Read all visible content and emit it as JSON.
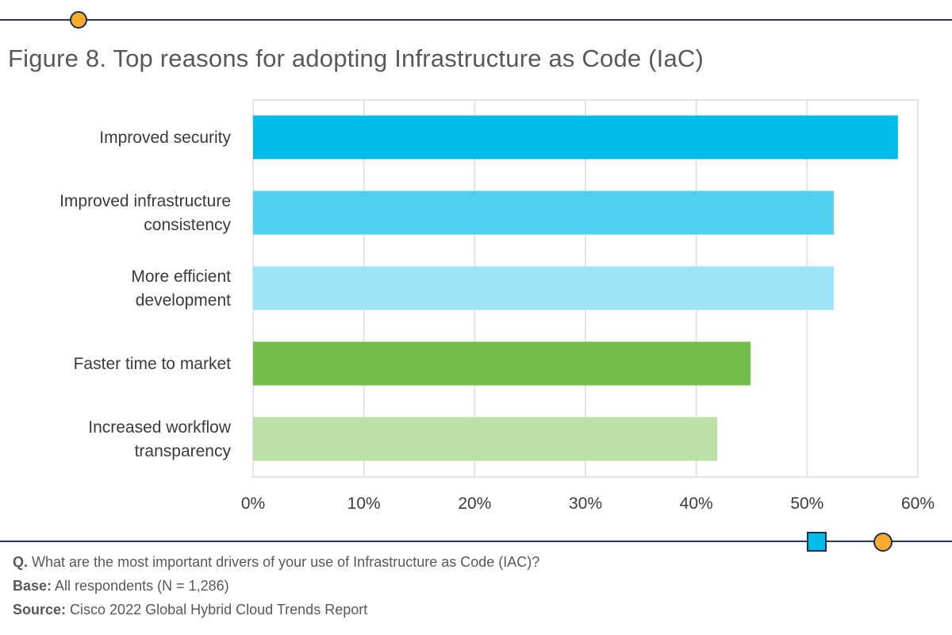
{
  "figure": {
    "title": "Figure 8. Top reasons for adopting Infrastructure as Code (IaC)"
  },
  "notes": {
    "question_label": "Q.",
    "question_text": " What are the most important drivers of your use of Infrastructure as Code (IAC)?",
    "base_label": "Base:",
    "base_text": " All respondents (N = 1,286)",
    "source_label": "Source:",
    "source_text": " Cisco 2022 Global Hybrid Cloud Trends Report"
  },
  "chart_data": {
    "type": "bar",
    "orientation": "horizontal",
    "title": "Figure 8. Top reasons for adopting Infrastructure as Code (IaC)",
    "xlabel": "",
    "ylabel": "",
    "categories": [
      [
        "Improved security"
      ],
      [
        "Improved infrastructure",
        "consistency"
      ],
      [
        "More efficient",
        "development"
      ],
      [
        "Faster time to market"
      ],
      [
        "Increased workflow",
        "transparency"
      ]
    ],
    "values": [
      58.2,
      52.4,
      52.4,
      44.9,
      41.9
    ],
    "colors": [
      "#00bceb",
      "#4fd0f0",
      "#9be5f6",
      "#74bf4b",
      "#bde0a8"
    ],
    "xlim": [
      0,
      60
    ],
    "xticks": [
      0,
      10,
      20,
      30,
      40,
      50,
      60
    ],
    "xtick_labels": [
      "0%",
      "10%",
      "20%",
      "30%",
      "40%",
      "50%",
      "60%"
    ],
    "grid": true,
    "legend": "none"
  }
}
